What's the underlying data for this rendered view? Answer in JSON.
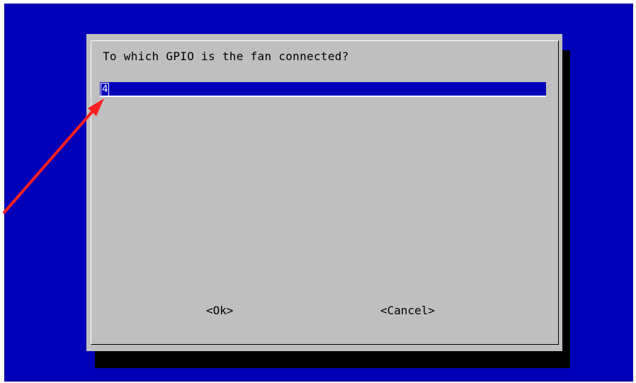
{
  "dialog": {
    "prompt": "To which GPIO is the fan connected?",
    "input_value": "4",
    "ok_label": "<Ok>",
    "cancel_label": "<Cancel>"
  },
  "colors": {
    "background": "#0000b8",
    "dialog": "#bfbfbf",
    "shadow": "#000000",
    "annotation_arrow": "#ff0000"
  }
}
